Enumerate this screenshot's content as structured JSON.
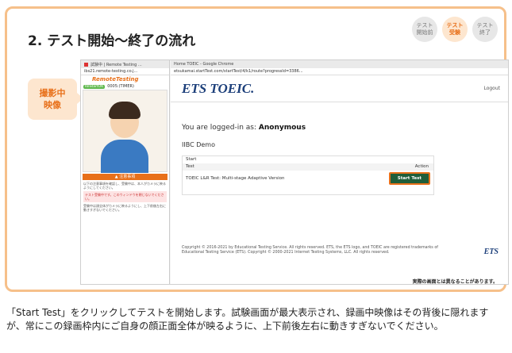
{
  "header": {
    "title": "2. テスト開始〜終了の流れ",
    "steps": [
      {
        "line1": "テスト",
        "line2": "開始前"
      },
      {
        "line1": "テスト",
        "line2": "受験"
      },
      {
        "line1": "テスト",
        "line2": "終了"
      }
    ]
  },
  "recording_badge": {
    "line1": "撮影中",
    "line2": "映像"
  },
  "remote_testing": {
    "title": "試験中 | Remote Testing ...",
    "address": "ibs21.remote-testing.co.j...",
    "logo": "RemoteTesting",
    "status_pill": "ReStartOK",
    "timer": "0005:(TIMER)",
    "warning": "▲ 注意事項",
    "text1": "以下の注意事項を確認し、受験中は、本人がカメラに映るようにしてください。",
    "pink_text": "テスト受験中です。このウィンドウを閉じないでください。",
    "text2": "受験中は顔全体がカメラに映るようにし、上下前後左右に動きすぎないでください。"
  },
  "toeic": {
    "window_title": "Home TOEIC - Google Chrome",
    "address": "etsukamai.startTest.com/startTest/4/k1/route?progressId=3386...",
    "logo": "ETS TOEIC.",
    "logout": "Logout",
    "logged_in_prefix": "You are logged-in as: ",
    "logged_in_user": "Anonymous",
    "org": "IIBC Demo",
    "start_header": "Start",
    "col_test": "Test",
    "col_action": "Action",
    "test_name": "TOEIC L&R Test: Multi-stage Adaptive Version",
    "start_button": "Start Test",
    "footer_text": "Copyright © 2016-2021 by Educational Testing Service. All rights reserved. ETS, the ETS logo, and TOEIC are registered trademarks of Educational Testing Service (ETS). Copyright © 2000-2021 Internet Testing Systems, LLC. All rights reserved.",
    "footer_logo": "ETS"
  },
  "note": "実際の画面とは異なることがあります。",
  "caption": "「Start Test」をクリックしてテストを開始します。試験画面が最大表示され、録画中映像はその背後に隠れますが、常にこの録画枠内にご自身の顔正面全体が映るように、上下前後左右に動きすぎないでください。"
}
